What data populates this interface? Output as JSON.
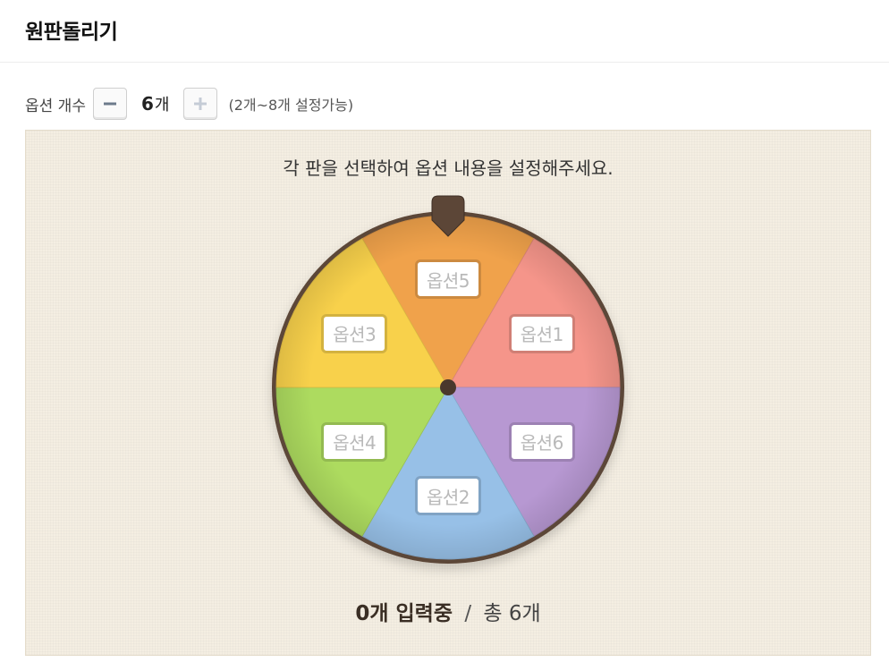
{
  "header": {
    "title": "원판돌리기"
  },
  "controls": {
    "label": "옵션 개수",
    "decrement_icon": "minus-icon",
    "count_value": "6",
    "count_unit": "개",
    "increment_icon": "plus-icon",
    "range_text": "(2개~8개 설정가능)"
  },
  "board": {
    "instruction": "각 판을 선택하여 옵션 내용을 설정해주세요.",
    "pointer_icon": "pointer-icon",
    "segments": [
      {
        "label": "옵션5",
        "color": "#f0a24b"
      },
      {
        "label": "옵션1",
        "color": "#f5958a"
      },
      {
        "label": "옵션6",
        "color": "#b798d2"
      },
      {
        "label": "옵션2",
        "color": "#97c0e7"
      },
      {
        "label": "옵션4",
        "color": "#addb5f"
      },
      {
        "label": "옵션3",
        "color": "#f8d14b"
      }
    ],
    "status": {
      "entered": "0개 입력중",
      "separator": "/",
      "total": "총 6개"
    }
  },
  "colors": {
    "rim": "#5c4637",
    "hub": "#4a382c",
    "board_bg": "#f4eee2"
  }
}
